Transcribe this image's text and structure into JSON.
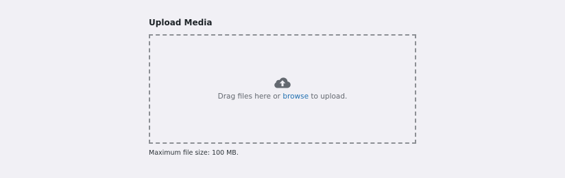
{
  "upload": {
    "title": "Upload Media",
    "drop_text_before": "Drag files here or",
    "browse_label": "browse",
    "drop_text_after": "to upload.",
    "max_size_text": "Maximum file size: 100 MB.",
    "icon": "cloud-upload-icon"
  },
  "colors": {
    "background": "#f1f0f5",
    "border": "#8c8f94",
    "link": "#2271b1",
    "icon": "#646970"
  }
}
